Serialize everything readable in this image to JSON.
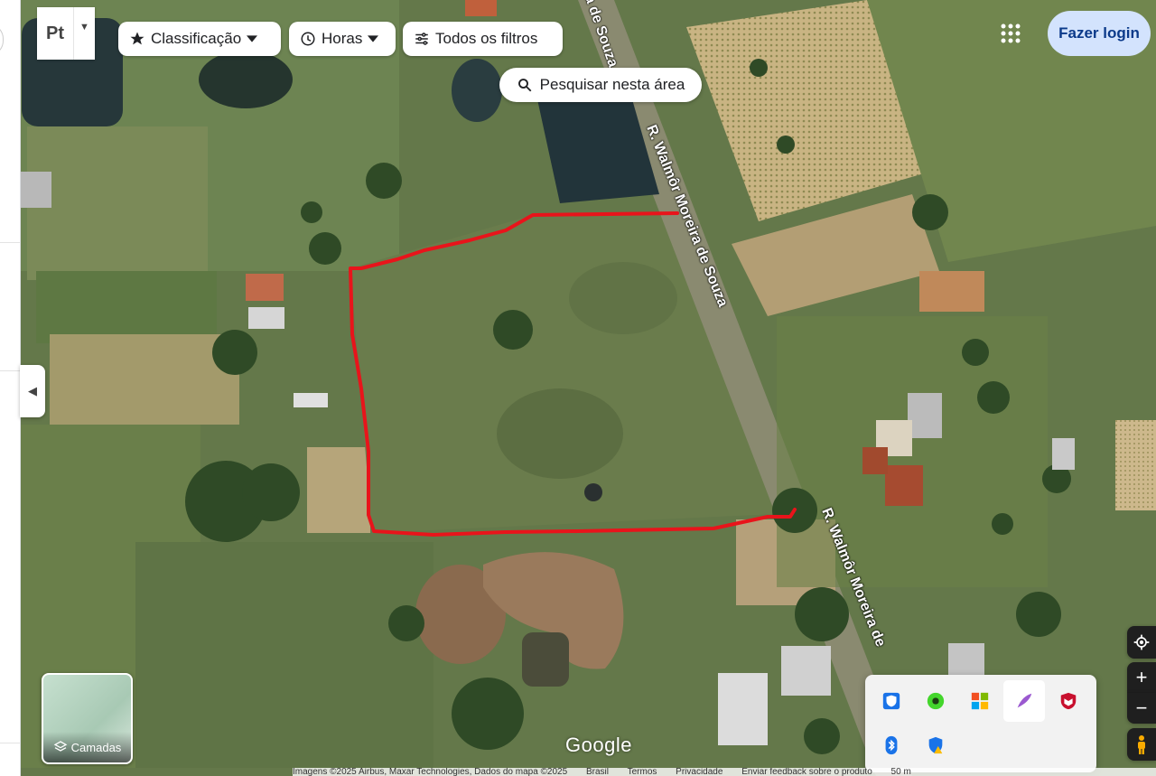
{
  "toolbar": {
    "lang_label": "Pt",
    "rating_label": "Classificação",
    "hours_label": "Horas",
    "filters_label": "Todos os filtros"
  },
  "search_area_label": "Pesquisar nesta área",
  "login_label": "Fazer login",
  "layers_label": "Camadas",
  "google_logo": "Google",
  "road_labels": {
    "top": "a de Souza",
    "upper": "R. Walmôr Moreira de Souza",
    "lower": "R. Walmôr Moreira de"
  },
  "footer": {
    "imagery": "Imagens ©2025 Airbus, Maxar Technologies, Dados do mapa ©2025",
    "country": "Brasil",
    "terms": "Termos",
    "privacy": "Privacidade",
    "feedback": "Enviar feedback sobre o produto",
    "scale": "50 m"
  },
  "colors": {
    "boundary": "#e8141b",
    "login_bg": "#d3e3fd",
    "login_text": "#0b3a8a"
  },
  "tray_icons": [
    "windows-security-icon",
    "razer-icon",
    "office-icon",
    "feather-app-icon",
    "mcafee-icon",
    "bluetooth-icon",
    "shield-warning-icon"
  ]
}
